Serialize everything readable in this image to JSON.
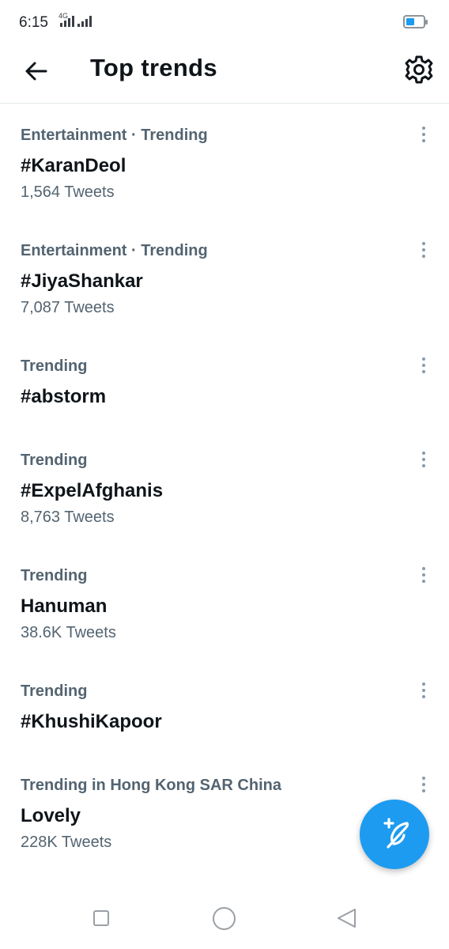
{
  "status_bar": {
    "time": "6:15",
    "network_label": "4G",
    "battery_color": "#1d9bf0"
  },
  "header": {
    "title": "Top trends",
    "back_icon": "arrow-left-icon",
    "settings_icon": "gear-icon"
  },
  "trends": [
    {
      "context": "Entertainment · Trending",
      "name": "#KaranDeol",
      "count": "1,564 Tweets"
    },
    {
      "context": "Entertainment · Trending",
      "name": "#JiyaShankar",
      "count": "7,087 Tweets"
    },
    {
      "context": "Trending",
      "name": "#abstorm",
      "count": ""
    },
    {
      "context": "Trending",
      "name": "#ExpelAfghanis",
      "count": "8,763 Tweets"
    },
    {
      "context": "Trending",
      "name": "Hanuman",
      "count": "38.6K Tweets"
    },
    {
      "context": "Trending",
      "name": "#KhushiKapoor",
      "count": ""
    },
    {
      "context": "Trending in Hong Kong SAR China",
      "name": "Lovely",
      "count": "228K Tweets"
    }
  ],
  "fab": {
    "icon": "compose-tweet-icon",
    "color": "#1d9bf0"
  },
  "nav_bar": {
    "recents_icon": "square-icon",
    "home_icon": "circle-icon",
    "back_icon": "triangle-back-icon"
  }
}
